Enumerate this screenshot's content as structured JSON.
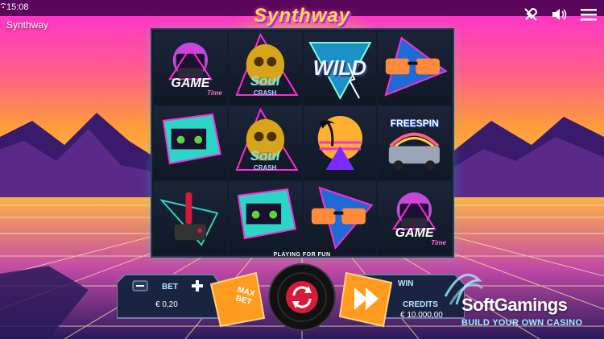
{
  "status_bar": {
    "time": "15:08"
  },
  "game": {
    "name": "Synthway",
    "logo_text": "Synthway"
  },
  "top_icons": [
    {
      "name": "rocket-icon"
    },
    {
      "name": "speaker-icon"
    },
    {
      "name": "menu-icon"
    }
  ],
  "reels": {
    "rows": [
      [
        "GAME",
        "Soul",
        "WILD",
        "sunglasses"
      ],
      [
        "cassette",
        "Soul",
        "palm-pyramid",
        "FREESPIN"
      ],
      [
        "joystick",
        "cassette",
        "sunglasses",
        "GAME"
      ]
    ],
    "labels": {
      "game_main": "GAME",
      "game_sub": "Time",
      "soul_main": "Soul",
      "soul_sub": "CRASH",
      "wild": "WILD",
      "freespin": "FREESPIN"
    }
  },
  "playing_for_fun": "PLAYING FOR FUN",
  "controls": {
    "bet_label": "BET",
    "bet_value": "€ 0,20",
    "max_bet_line1": "MAX",
    "max_bet_line2": "BET",
    "win_label": "WIN",
    "credits_label": "CREDITS",
    "credits_value": "€ 10.000,00"
  },
  "watermark": {
    "title": "SoftGamings",
    "subtitle": "BUILD YOUR OWN CASINO"
  },
  "colors": {
    "sky_top": "#ff2bd6",
    "sky_mid": "#ff8a3c",
    "sun": "#ffd23a",
    "grid": "#ffe6a8",
    "panel": "#1a2440",
    "accent_orange": "#ff9b1e"
  }
}
